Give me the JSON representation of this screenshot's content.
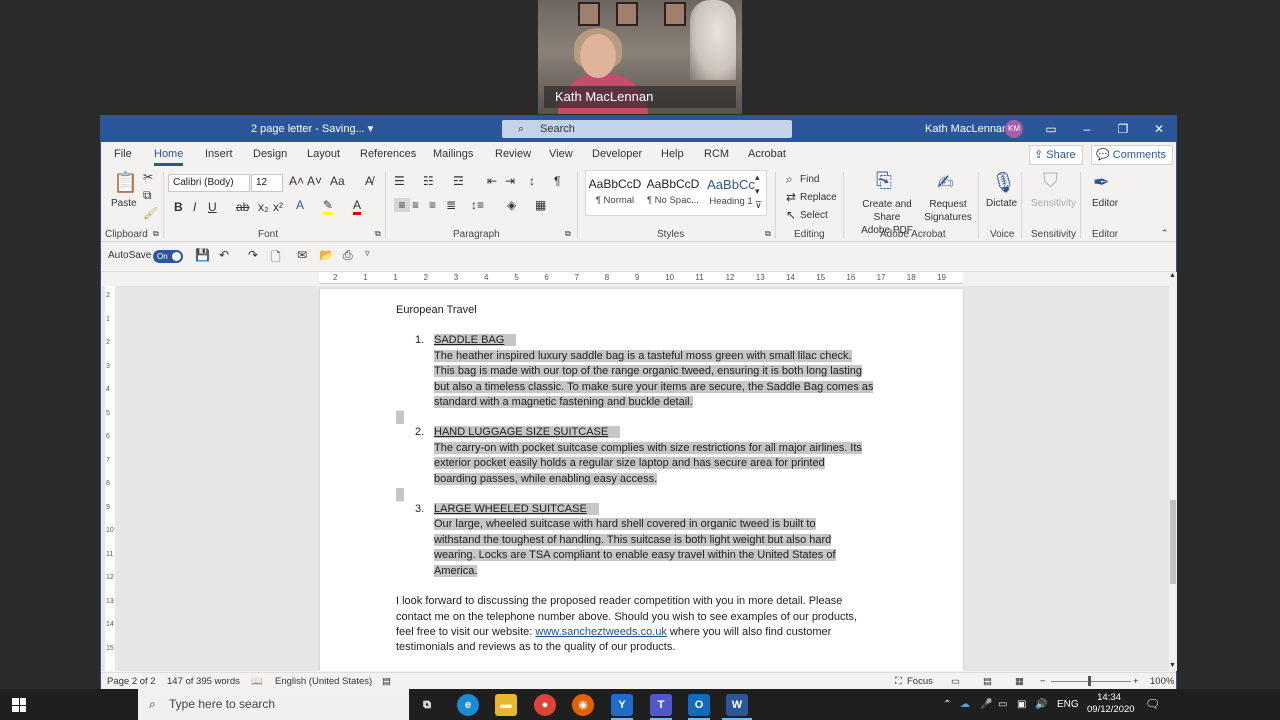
{
  "video": {
    "participant_name": "Kath MacLennan"
  },
  "titlebar": {
    "doc_title": "2 page letter  -  Saving...  ▾",
    "search_placeholder": "Search",
    "user_name": "Kath MacLennan",
    "user_initials": "KM"
  },
  "menu_tabs": [
    "File",
    "Home",
    "Insert",
    "Design",
    "Layout",
    "References",
    "Mailings",
    "Review",
    "View",
    "Developer",
    "Help",
    "RCM",
    "Acrobat"
  ],
  "share_label": "Share",
  "comments_label": "Comments",
  "ribbon": {
    "paste_label": "Paste",
    "font_name": "Calibri (Body)",
    "font_size": "12",
    "styles": [
      {
        "sample": "AaBbCcD",
        "name": "¶ Normal"
      },
      {
        "sample": "AaBbCcD",
        "name": "¶ No Spac..."
      },
      {
        "sample": "AaBbCc",
        "name": "Heading 1"
      }
    ],
    "find_label": "Find",
    "replace_label": "Replace",
    "select_label": "Select",
    "create_share_label_1": "Create and Share",
    "create_share_label_2": "Adobe PDF",
    "request_sig_label_1": "Request",
    "request_sig_label_2": "Signatures",
    "dictate_label": "Dictate",
    "sensitivity_label": "Sensitivity",
    "editor_label": "Editor",
    "groups": {
      "clipboard": "Clipboard",
      "font": "Font",
      "paragraph": "Paragraph",
      "styles": "Styles",
      "editing": "Editing",
      "adobe_acrobat": "Adobe Acrobat",
      "voice": "Voice",
      "sensitivity": "Sensitivity",
      "editor": "Editor"
    }
  },
  "qat": {
    "autosave_label": "AutoSave",
    "autosave_state": "On"
  },
  "ruler_numbers": [
    "2",
    "1",
    "1",
    "2",
    "3",
    "4",
    "5",
    "6",
    "7",
    "8",
    "9",
    "10",
    "11",
    "12",
    "13",
    "14",
    "15",
    "16",
    "17",
    "18",
    "19"
  ],
  "vruler_numbers": [
    "2",
    "1",
    "2",
    "3",
    "4",
    "5",
    "6",
    "7",
    "8",
    "9",
    "10",
    "11",
    "12",
    "13",
    "14",
    "15"
  ],
  "document": {
    "heading": "European Travel",
    "items": [
      {
        "number": "1.",
        "title": "SADDLE BAG",
        "lines": [
          "The heather inspired luxury saddle bag is a tasteful moss green with small lilac check.",
          "This bag is made with our top of the range organic tweed, ensuring it is both long lasting",
          "but also a timeless classic. To make sure your items are secure, the Saddle Bag comes as",
          "standard with a magnetic fastening and buckle detail."
        ]
      },
      {
        "number": "2.",
        "title": "HAND LUGGAGE SIZE SUITCASE",
        "lines": [
          "The carry-on with pocket suitcase complies with size restrictions for all major airlines. Its",
          "exterior pocket easily holds a regular size laptop and has secure area for printed",
          "boarding passes, while enabling easy access."
        ]
      },
      {
        "number": "3.",
        "title": "LARGE WHEELED SUITCASE",
        "lines": [
          "Our large, wheeled suitcase with hard shell covered in organic tweed is built to",
          "withstand the toughest of handling. This suitcase is both light weight but also hard",
          "wearing. Locks are TSA compliant to enable easy travel within the United States of",
          "America."
        ]
      }
    ],
    "closing_line1": "I look forward to discussing the proposed reader competition with you in more detail.  Please",
    "closing_line2": "contact me on the telephone number above. Should you wish to see examples of our products,",
    "closing_line3_pre": "feel free to visit our website: ",
    "closing_link": "www.sancheztweeds.co.uk",
    "closing_line3_post": " where you will also find customer",
    "closing_line4": "testimonials and reviews as to the quality of our products."
  },
  "status": {
    "page": "Page 2 of 2",
    "words": "147 of 395 words",
    "language": "English (United States)",
    "focus": "Focus",
    "zoom": "100%"
  },
  "taskbar": {
    "search_placeholder": "Type here to search",
    "lang": "ENG",
    "time": "14:34",
    "date": "09/12/2020"
  }
}
